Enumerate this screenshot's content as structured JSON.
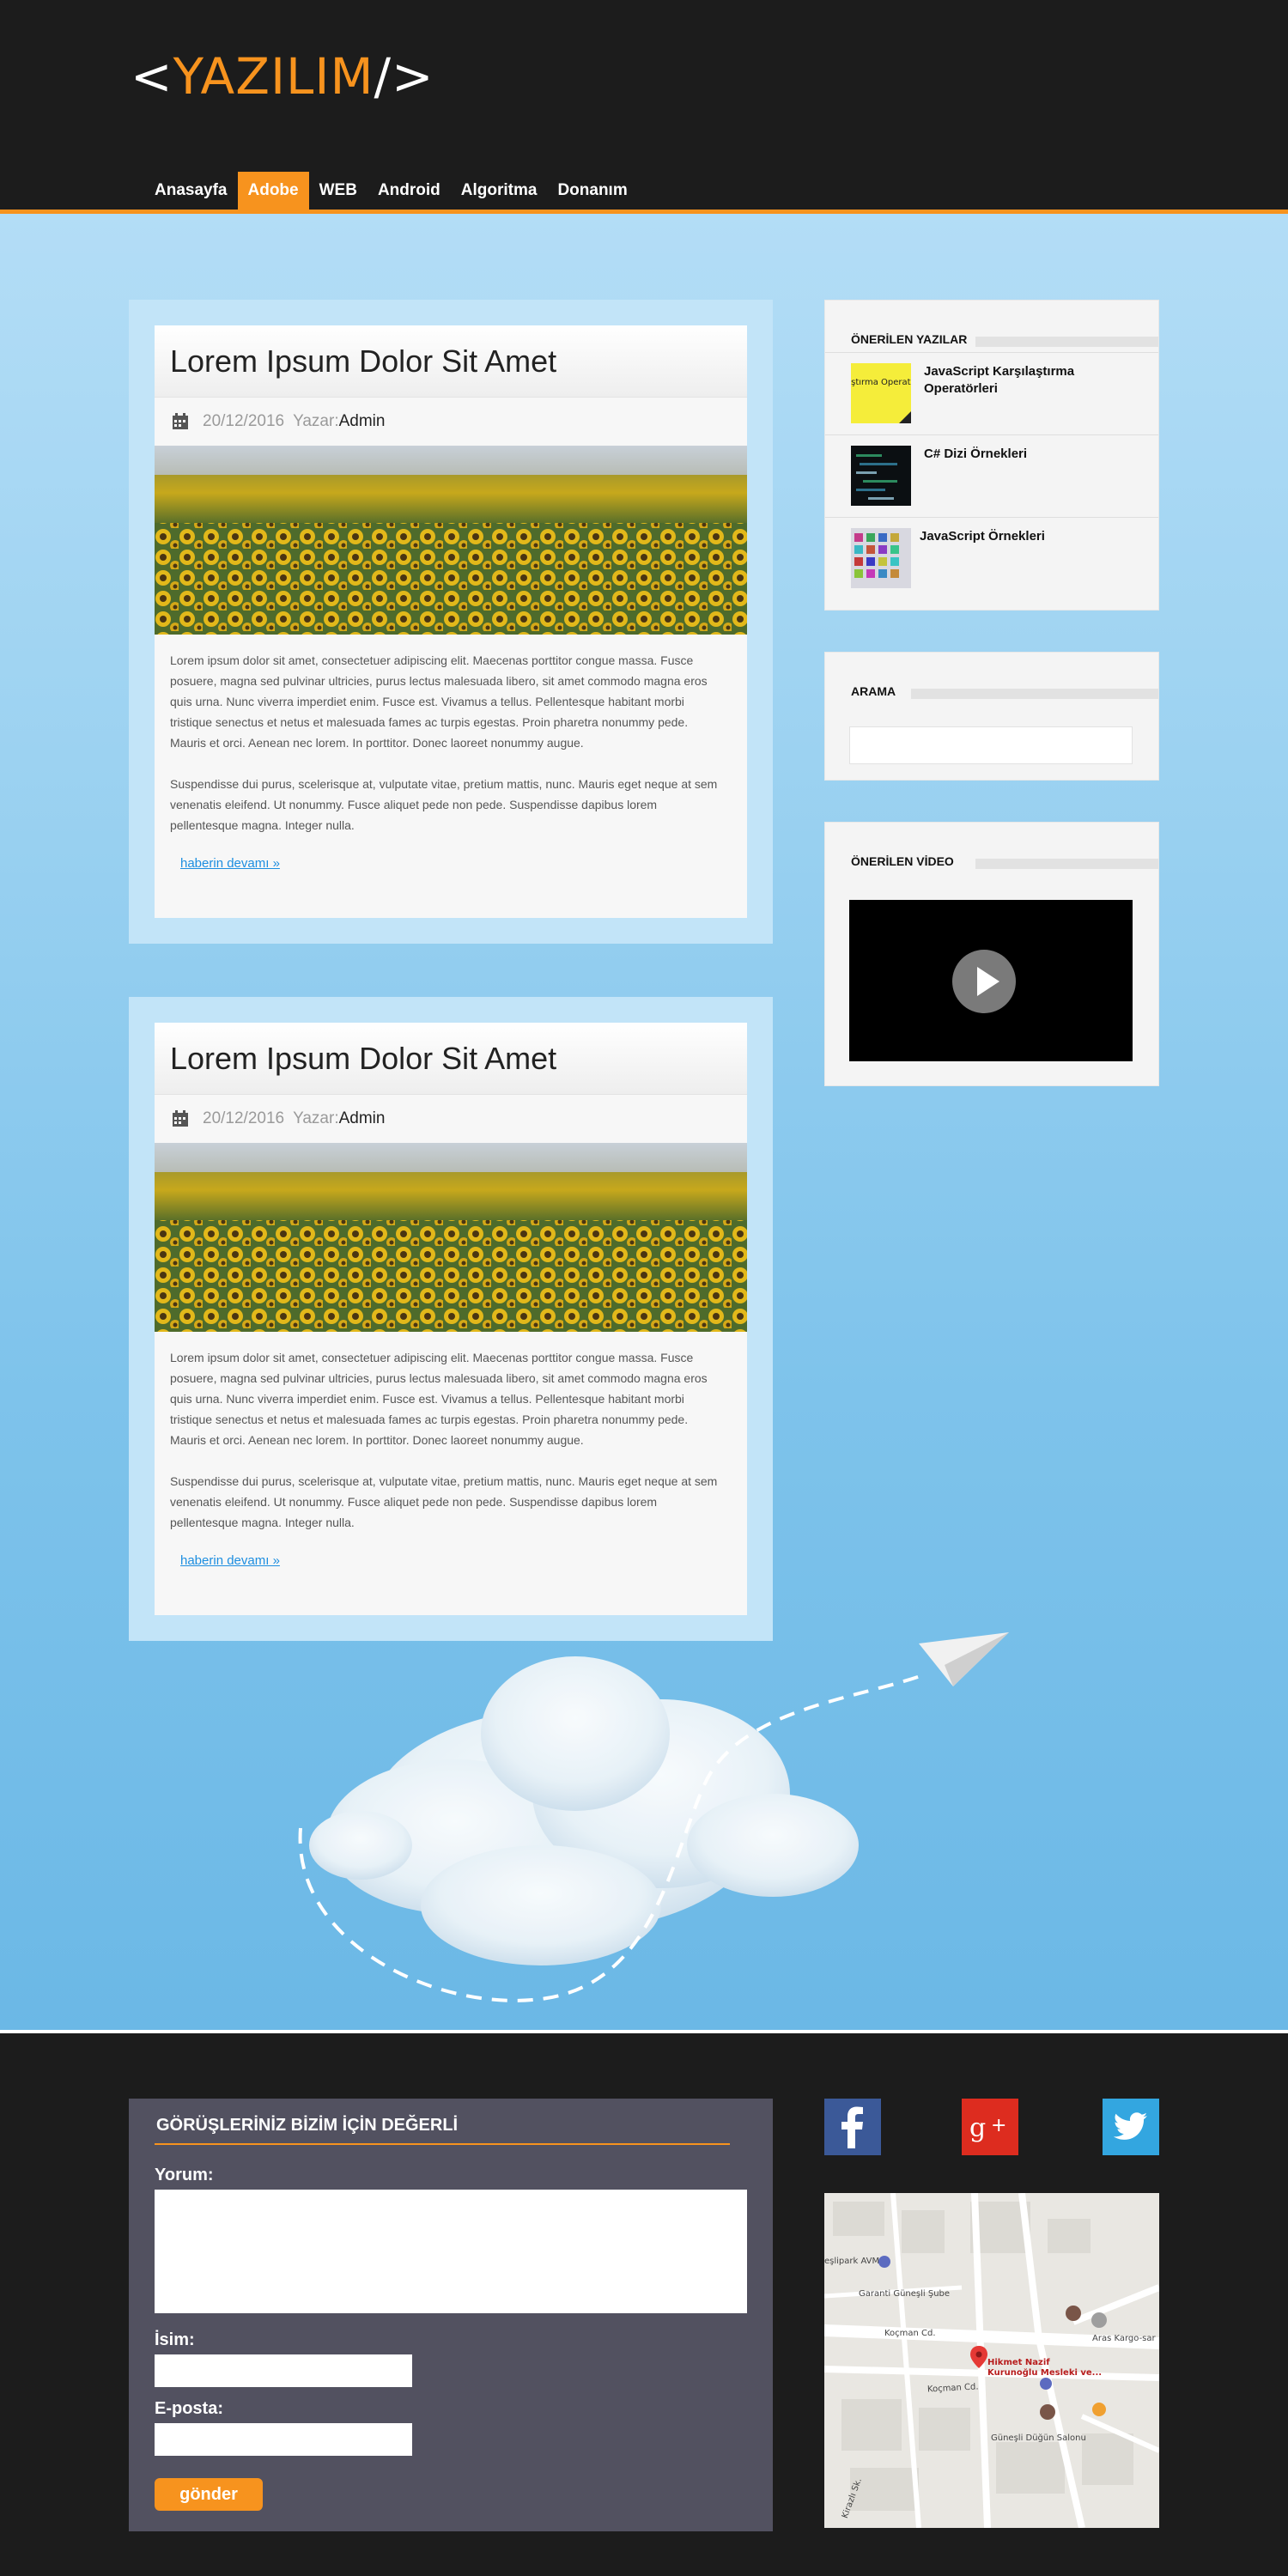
{
  "header": {
    "logo_open": "<",
    "logo_name": "YAZILIM",
    "logo_close": "/>",
    "nav": [
      "Anasayfa",
      "Adobe",
      "WEB",
      "Android",
      "Algoritma",
      "Donanım"
    ],
    "active_nav": "Adobe"
  },
  "posts": [
    {
      "title": "Lorem Ipsum  Dolor Sit Amet",
      "date": "20/12/2016",
      "author_label": "Yazar:",
      "author": "Admin",
      "para1": "Lorem ipsum dolor sit amet, consectetuer adipiscing elit. Maecenas porttitor congue massa. Fusce posuere, magna sed pulvinar ultricies, purus lectus malesuada libero, sit amet commodo magna eros quis urna. Nunc viverra imperdiet enim. Fusce est. Vivamus a tellus. Pellentesque habitant morbi tristique senectus et netus et malesuada fames ac turpis egestas. Proin pharetra nonummy pede. Mauris et orci. Aenean nec lorem. In porttitor. Donec laoreet nonummy augue.",
      "para2": "Suspendisse dui purus, scelerisque at, vulputate vitae, pretium mattis, nunc. Mauris eget neque at sem venenatis eleifend. Ut nonummy. Fusce aliquet pede non pede. Suspendisse dapibus lorem pellentesque magna. Integer nulla.",
      "more": "haberin devamı »"
    },
    {
      "title": "Lorem Ipsum  Dolor Sit Amet",
      "date": "20/12/2016",
      "author_label": "Yazar:",
      "author": "Admin",
      "para1": "Lorem ipsum dolor sit amet, consectetuer adipiscing elit. Maecenas porttitor congue massa. Fusce posuere, magna sed pulvinar ultricies, purus lectus malesuada libero, sit amet commodo magna eros quis urna. Nunc viverra imperdiet enim. Fusce est. Vivamus a tellus. Pellentesque habitant morbi tristique senectus et netus et malesuada fames ac turpis egestas. Proin pharetra nonummy pede. Mauris et orci. Aenean nec lorem. In porttitor. Donec laoreet nonummy augue.",
      "para2": "Suspendisse dui purus, scelerisque at, vulputate vitae, pretium mattis, nunc. Mauris eget neque at sem venenatis eleifend. Ut nonummy. Fusce aliquet pede non pede. Suspendisse dapibus lorem pellentesque magna. Integer nulla.",
      "more": "haberin devamı »"
    }
  ],
  "sidebar": {
    "recommended_title": "ÖNERİLEN YAZILAR",
    "recommended": [
      {
        "label": "JavaScript Karşılaştırma Operatörleri",
        "thumb_text": "aştırma Operatö"
      },
      {
        "label": "C# Dizi Örnekleri"
      },
      {
        "label": "JavaScript Örnekleri"
      }
    ],
    "search_title": "ARAMA",
    "video_title": "ÖNERİLEN VİDEO"
  },
  "footer": {
    "form_title": "GÖRÜŞLERİNİZ BİZİM İÇİN DEĞERLİ",
    "comment_label": "Yorum:",
    "name_label": "İsim:",
    "email_label": "E-posta:",
    "submit": "gönder",
    "social": [
      "facebook",
      "google-plus",
      "twitter"
    ]
  },
  "map": {
    "labels": [
      "eşlipark AVM",
      "Garanti Güneşli Şube",
      "Koçman Cd.",
      "Aras Kargo-sar",
      "Hikmet Nazif",
      "Kurunoğlu Mesleki ve...",
      "Güneşli Düğün Salonu",
      "Koçman Cd.",
      "Kirazlı Sk."
    ]
  },
  "colors": {
    "accent": "#f7931e",
    "header_bg": "#1c1c1c",
    "form_bg": "#525160",
    "link": "#1d8ee0"
  }
}
